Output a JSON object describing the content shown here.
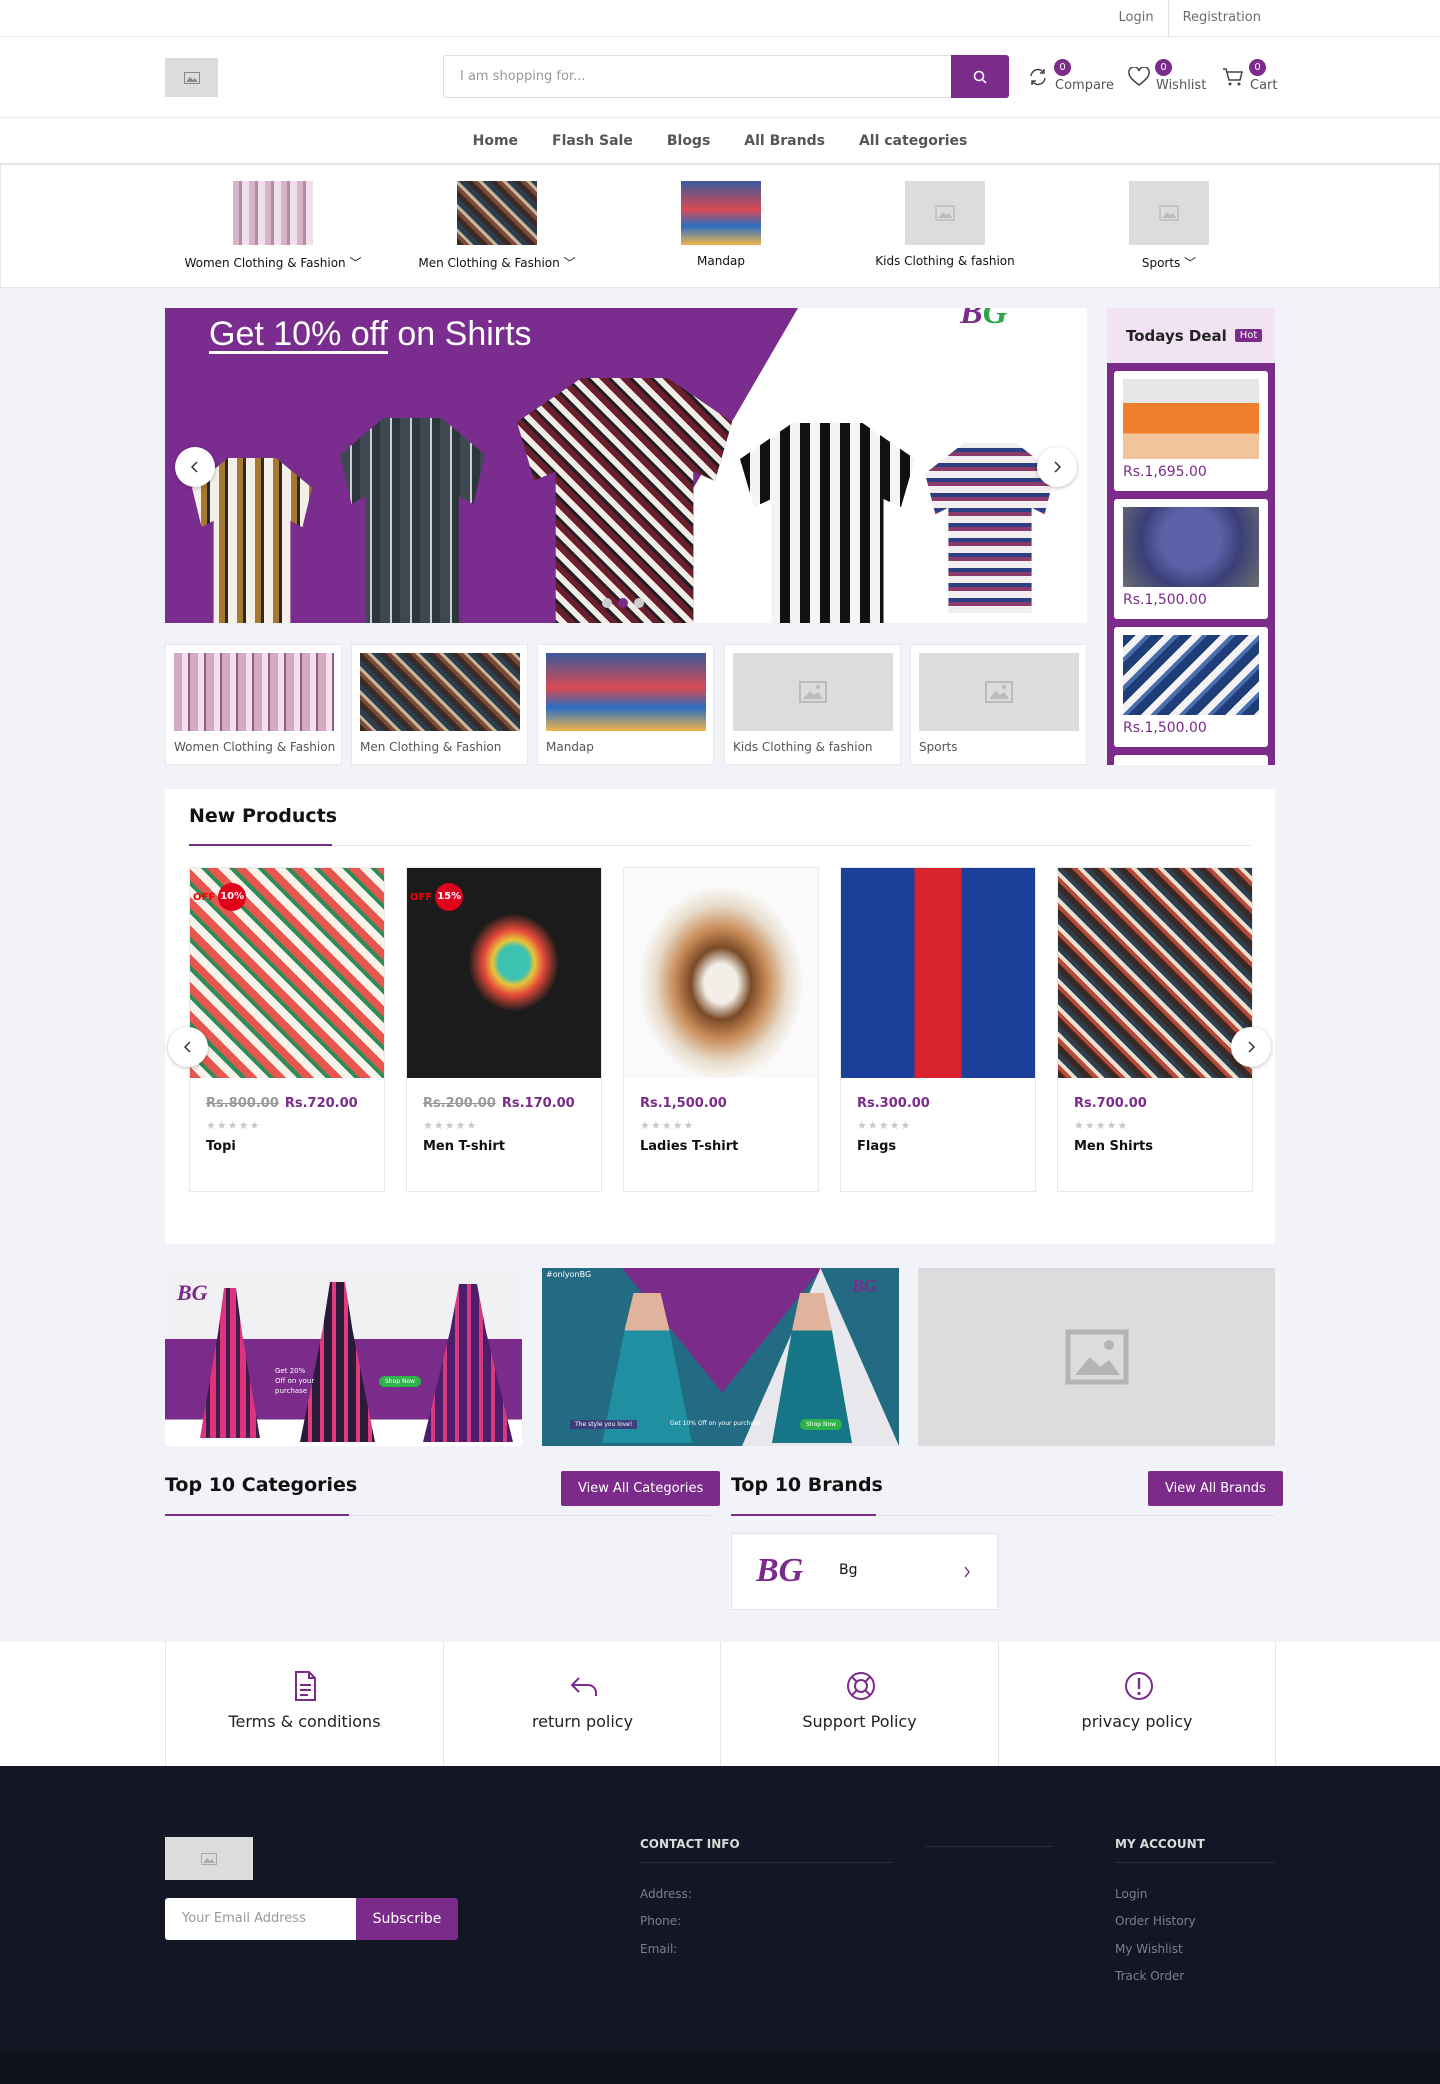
{
  "topbar": {
    "login": "Login",
    "registration": "Registration"
  },
  "header": {
    "search_placeholder": "I am shopping for...",
    "compare": {
      "label": "Compare",
      "count": "0"
    },
    "wishlist": {
      "label": "Wishlist",
      "count": "0"
    },
    "cart": {
      "label": "Cart",
      "count": "0"
    }
  },
  "nav": [
    "Home",
    "Flash Sale",
    "Blogs",
    "All Brands",
    "All categories"
  ],
  "category_strip": [
    {
      "name": "Women Clothing & Fashion",
      "has_dropdown": true
    },
    {
      "name": "Men Clothing & Fashion",
      "has_dropdown": true
    },
    {
      "name": "Mandap",
      "has_dropdown": false
    },
    {
      "name": "Kids Clothing & fashion",
      "has_dropdown": false
    },
    {
      "name": "Sports",
      "has_dropdown": true
    }
  ],
  "hero": {
    "title_underlined": "Get 10% off",
    "title_rest": " on Shirts",
    "active_slide": 2,
    "slide_count": 3
  },
  "todays_deal": {
    "title": "Todays Deal",
    "badge": "Hot",
    "items": [
      {
        "price": "Rs.1,695.00"
      },
      {
        "price": "Rs.1,500.00"
      },
      {
        "price": "Rs.1,500.00"
      }
    ]
  },
  "mini_categories": [
    "Women Clothing & Fashion",
    "Men Clothing & Fashion",
    "Mandap",
    "Kids Clothing & fashion",
    "Sports"
  ],
  "new_products": {
    "title": "New Products",
    "items": [
      {
        "name": "Topi",
        "old_price": "Rs.800.00",
        "price": "Rs.720.00",
        "off_label": "OFF",
        "discount": "10%"
      },
      {
        "name": "Men T-shirt",
        "old_price": "Rs.200.00",
        "price": "Rs.170.00",
        "off_label": "OFF",
        "discount": "15%"
      },
      {
        "name": "Ladies T-shirt",
        "old_price": "",
        "price": "Rs.1,500.00",
        "off_label": "",
        "discount": ""
      },
      {
        "name": "Flags",
        "old_price": "",
        "price": "Rs.300.00",
        "off_label": "",
        "discount": ""
      },
      {
        "name": "Men Shirts",
        "old_price": "",
        "price": "Rs.700.00",
        "off_label": "",
        "discount": ""
      }
    ],
    "stars": "★★★★★",
    "rating": 0
  },
  "banners": [
    {
      "logo": "BG",
      "text": "Get 20% Off on your purchase",
      "cta": "Shop Now"
    },
    {
      "tag": "#onlyonBG",
      "logo": "BG",
      "text1": "The style you love!",
      "text2": "Get 10% Off on your purchase",
      "cta": "Shop Now"
    },
    {}
  ],
  "top_categories": {
    "title": "Top 10 Categories",
    "button": "View All Categories"
  },
  "top_brands": {
    "title": "Top 10 Brands",
    "button": "View All Brands",
    "items": [
      {
        "name": "Bg",
        "logo": "BG"
      }
    ]
  },
  "policies": [
    "Terms & conditions",
    "return policy",
    "Support Policy",
    "privacy policy"
  ],
  "footer": {
    "email_placeholder": "Your Email Address",
    "subscribe": "Subscribe",
    "contact_title": "CONTACT INFO",
    "contact_lines": [
      "Address:",
      "Phone:",
      "Email:"
    ],
    "account_title": "MY ACCOUNT",
    "account_links": [
      "Login",
      "Order History",
      "My Wishlist",
      "Track Order"
    ]
  },
  "colors": {
    "brand": "#7b2b8a",
    "footer_bg": "#131624",
    "page_bg": "#f2f3f8"
  }
}
